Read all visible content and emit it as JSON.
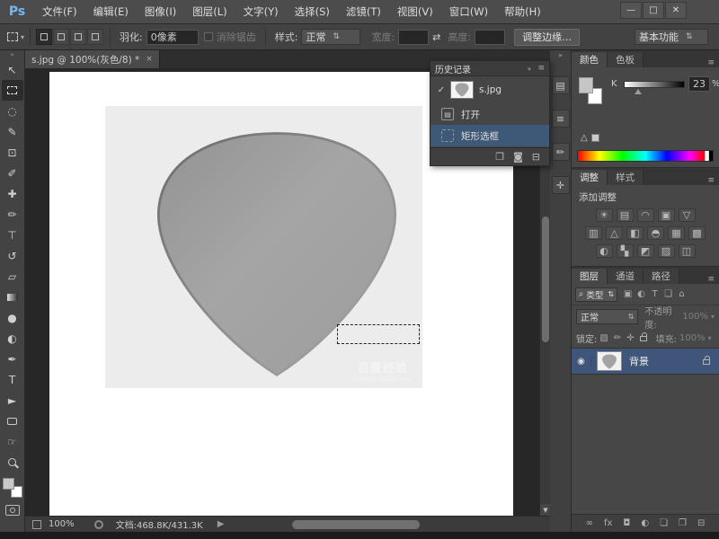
{
  "titlebar": {
    "logo": "Ps",
    "minimize": "—",
    "maximize": "□",
    "close": "✕"
  },
  "menus": [
    "文件(F)",
    "编辑(E)",
    "图像(I)",
    "图层(L)",
    "文字(Y)",
    "选择(S)",
    "滤镜(T)",
    "视图(V)",
    "窗口(W)",
    "帮助(H)"
  ],
  "options": {
    "feather_label": "羽化:",
    "feather_value": "0像素",
    "antialias_label": "消除锯齿",
    "style_label": "样式:",
    "style_value": "正常",
    "width_label": "宽度:",
    "width_value": "",
    "swap_icon": "⇄",
    "height_label": "高度:",
    "height_value": "",
    "refine_edge_label": "调整边缘…",
    "workspace_label": "基本功能"
  },
  "tools": [
    {
      "name": "move",
      "glyph": "↖"
    },
    {
      "name": "rectangular-marquee",
      "glyph": ""
    },
    {
      "name": "lasso",
      "glyph": "◌"
    },
    {
      "name": "quick-selection",
      "glyph": "✎"
    },
    {
      "name": "crop",
      "glyph": "⊡"
    },
    {
      "name": "eyedropper",
      "glyph": "✐"
    },
    {
      "name": "healing-brush",
      "glyph": "✚"
    },
    {
      "name": "brush",
      "glyph": "✏"
    },
    {
      "name": "clone-stamp",
      "glyph": "⊤"
    },
    {
      "name": "history-brush",
      "glyph": "↺"
    },
    {
      "name": "eraser",
      "glyph": "▱"
    },
    {
      "name": "gradient",
      "glyph": ""
    },
    {
      "name": "blur",
      "glyph": "●"
    },
    {
      "name": "dodge",
      "glyph": "◐"
    },
    {
      "name": "pen",
      "glyph": "✒"
    },
    {
      "name": "type",
      "glyph": "T"
    },
    {
      "name": "path-selection",
      "glyph": "►"
    },
    {
      "name": "rectangle-shape",
      "glyph": ""
    },
    {
      "name": "hand",
      "glyph": "☞"
    },
    {
      "name": "zoom",
      "glyph": ""
    }
  ],
  "doc": {
    "tab_title": "s.jpg @ 100%(灰色/8) *",
    "close": "×"
  },
  "watermark": {
    "line1": "百度经验",
    "line2": "jingyan.baidu.com"
  },
  "history": {
    "title": "历史记录",
    "collapse": "»",
    "menu": "≡",
    "items": [
      {
        "label": "s.jpg"
      },
      {
        "label": "打开"
      },
      {
        "label": "矩形选框"
      }
    ],
    "footer_icons": [
      {
        "name": "new-document-from-state",
        "glyph": "❐"
      },
      {
        "name": "new-snapshot",
        "glyph": "◙"
      },
      {
        "name": "delete-state",
        "glyph": "⊟"
      }
    ]
  },
  "dock": {
    "collapse": "»",
    "icons": [
      {
        "name": "panel-history",
        "glyph": "▤"
      },
      {
        "name": "panel-properties",
        "glyph": "≡"
      },
      {
        "name": "panel-brush",
        "glyph": "✏"
      },
      {
        "name": "panel-clone-source",
        "glyph": "✛"
      }
    ]
  },
  "color_panel": {
    "tab_color": "颜色",
    "tab_swatches": "色板",
    "menu": "≡",
    "channel": "K",
    "value": "23",
    "unit": "%",
    "warning": "△"
  },
  "adjustments": {
    "tab_adjustments": "调整",
    "tab_styles": "样式",
    "menu": "≡",
    "heading": "添加调整",
    "icons": [
      {
        "name": "brightness-contrast",
        "glyph": "☀"
      },
      {
        "name": "levels",
        "glyph": "▤"
      },
      {
        "name": "curves",
        "glyph": "◠"
      },
      {
        "name": "exposure",
        "glyph": "▣"
      },
      {
        "name": "vibrance",
        "glyph": "▽"
      },
      {
        "name": "hue-saturation",
        "glyph": "▥"
      },
      {
        "name": "color-balance",
        "glyph": "△"
      },
      {
        "name": "black-white",
        "glyph": "◧"
      },
      {
        "name": "photo-filter",
        "glyph": "◓"
      },
      {
        "name": "channel-mixer",
        "glyph": "▦"
      },
      {
        "name": "color-lookup",
        "glyph": "▩"
      },
      {
        "name": "invert",
        "glyph": "◐"
      },
      {
        "name": "posterize",
        "glyph": "▚"
      },
      {
        "name": "threshold",
        "glyph": "◩"
      },
      {
        "name": "gradient-map",
        "glyph": "▨"
      },
      {
        "name": "selective-color",
        "glyph": "◫"
      }
    ]
  },
  "layers": {
    "tab_layers": "图层",
    "tab_channels": "通道",
    "tab_paths": "路径",
    "menu": "≡",
    "filter_search": "⌕",
    "filter_label": "类型",
    "filter_icons": [
      {
        "name": "filter-pixel-layers",
        "glyph": "▣"
      },
      {
        "name": "filter-adjustment-layers",
        "glyph": "◐"
      },
      {
        "name": "filter-type-layers",
        "glyph": "T"
      },
      {
        "name": "filter-shape-layers",
        "glyph": "❏"
      },
      {
        "name": "filter-smart-objects",
        "glyph": "⌂"
      }
    ],
    "blend_mode": "正常",
    "opacity_label": "不透明度:",
    "opacity_value": "100%",
    "lock_label": "锁定:",
    "fill_label": "填充:",
    "fill_value": "100%",
    "layer": {
      "name": "背景",
      "eye": "◉"
    },
    "footer_icons": [
      {
        "name": "link-layers",
        "glyph": "∞"
      },
      {
        "name": "layer-effects",
        "glyph": "fx"
      },
      {
        "name": "add-layer-mask",
        "glyph": "◘"
      },
      {
        "name": "new-adjustment-layer",
        "glyph": "◐"
      },
      {
        "name": "new-group",
        "glyph": "❏"
      },
      {
        "name": "new-layer",
        "glyph": "❐"
      },
      {
        "name": "delete-layer",
        "glyph": "⊟"
      }
    ]
  },
  "status": {
    "zoom": "100%",
    "doc_info": "文档:468.8K/431.3K",
    "arrow": "▶"
  },
  "colors": {
    "selection_blue": "#3f567a",
    "panel_bg": "#474747",
    "menubar_bg": "#4c4c4c",
    "pasteboard": "#272727",
    "canvas_white": "#ffffff",
    "photo_gray": "#ececec",
    "pick_gray": "#a0a0a0",
    "logo_blue": "#6fb9f0"
  }
}
